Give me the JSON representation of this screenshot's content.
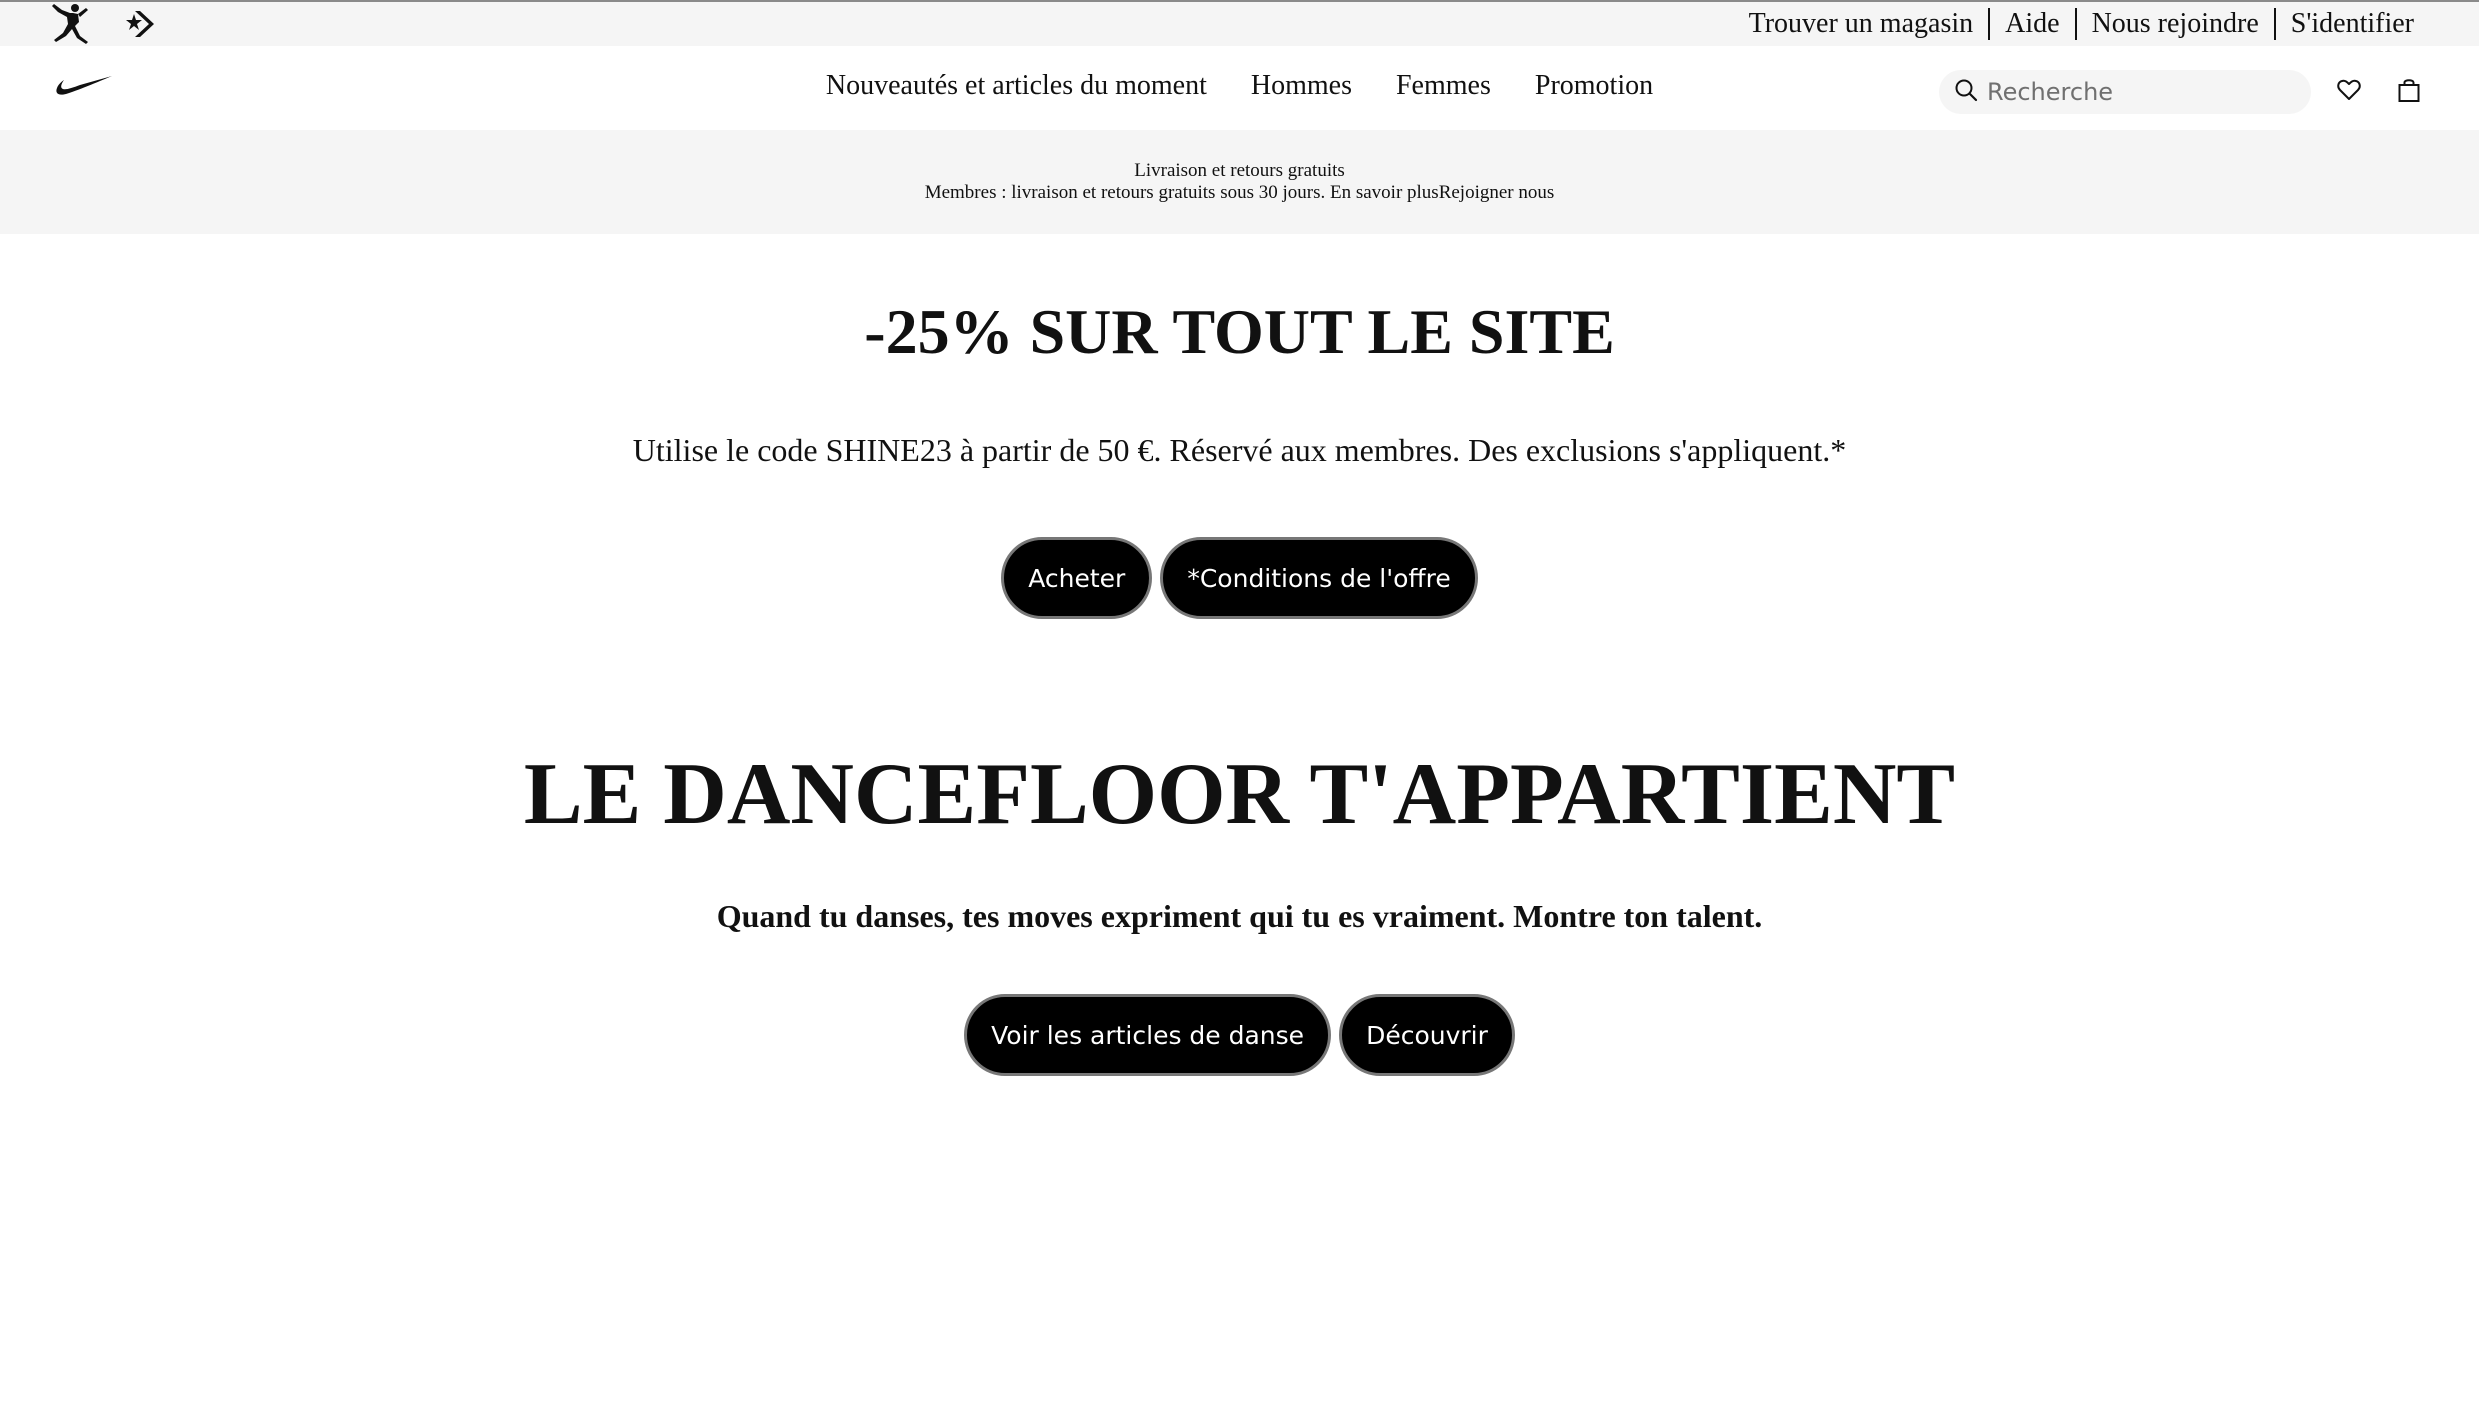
{
  "utility": {
    "links": [
      "Trouver un magasin",
      "Aide",
      "Nous rejoindre",
      "S'identifier"
    ]
  },
  "header": {
    "nav": [
      "Nouveautés et articles du moment",
      "Hommes",
      "Femmes",
      "Promotion"
    ],
    "search_placeholder": "Recherche"
  },
  "promo_strip": {
    "title": "Livraison et retours gratuits",
    "text": "Membres : livraison et retours gratuits sous 30 jours. ",
    "learn_more": "En savoir plus",
    "join": "Rejoigner nous"
  },
  "sale": {
    "title": "-25% SUR TOUT LE SITE",
    "subtitle": "Utilise le code SHINE23 à partir de 50 €. Réservé aux membres. Des exclusions s'appliquent.*",
    "buttons": [
      "Acheter",
      "*Conditions de l'offre"
    ]
  },
  "dance": {
    "title": "LE DANCEFLOOR T'APPARTIENT",
    "subtitle": "Quand tu danses, tes moves expriment qui tu es vraiment. Montre ton talent.",
    "buttons": [
      "Voir les articles de danse",
      "Découvrir"
    ]
  },
  "icons": {
    "brand": [
      "jordan-jumpman-icon",
      "converse-icon"
    ],
    "logo": "nike-swoosh-icon",
    "search": "search-icon",
    "favorites": "heart-icon",
    "bag": "bag-icon"
  },
  "colors": {
    "utility_bg": "#f5f5f5",
    "button_bg": "#000000",
    "button_text": "#ffffff",
    "button_border": "#777777",
    "text": "#111111"
  }
}
